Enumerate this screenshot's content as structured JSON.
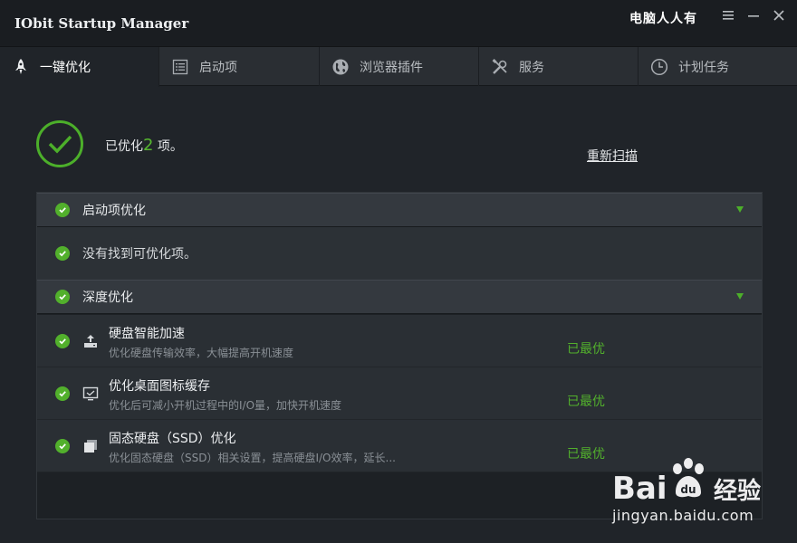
{
  "window": {
    "title": "IObit Startup Manager",
    "overlay_text": "电脑人人有",
    "menu_icon": "menu-icon",
    "minimize_icon": "minimize-icon",
    "close_icon": "close-icon"
  },
  "tabs": [
    {
      "label": "一键优化",
      "icon": "rocket-icon",
      "active": true
    },
    {
      "label": "启动项",
      "icon": "list-icon",
      "active": false
    },
    {
      "label": "浏览器插件",
      "icon": "globe-icon",
      "active": false
    },
    {
      "label": "服务",
      "icon": "tools-icon",
      "active": false
    },
    {
      "label": "计划任务",
      "icon": "clock-icon",
      "active": false
    }
  ],
  "summary": {
    "prefix": "已优化",
    "count": "2",
    "suffix": " 项。",
    "rescan_label": "重新扫描"
  },
  "sections": {
    "startup": {
      "title": "启动项优化",
      "empty_message": "没有找到可优化项。"
    },
    "deep": {
      "title": "深度优化",
      "items": [
        {
          "title": "硬盘智能加速",
          "desc": "优化硬盘传输效率，大幅提高开机速度",
          "status": "已最优",
          "icon": "disk-upload-icon"
        },
        {
          "title": "优化桌面图标缓存",
          "desc": "优化后可减小开机过程中的I/O量，加快开机速度",
          "status": "已最优",
          "icon": "monitor-icon"
        },
        {
          "title": "固态硬盘（SSD）优化",
          "desc": "优化固态硬盘（SSD）相关设置，提高硬盘I/O效率，延长...",
          "status": "已最优",
          "icon": "ssd-icon"
        }
      ]
    }
  },
  "watermark": {
    "logo_text": "Bai",
    "logo_text2": "经验",
    "url": "jingyan.baidu.com"
  },
  "colors": {
    "accent_green": "#52b02c",
    "background": "#202429"
  }
}
